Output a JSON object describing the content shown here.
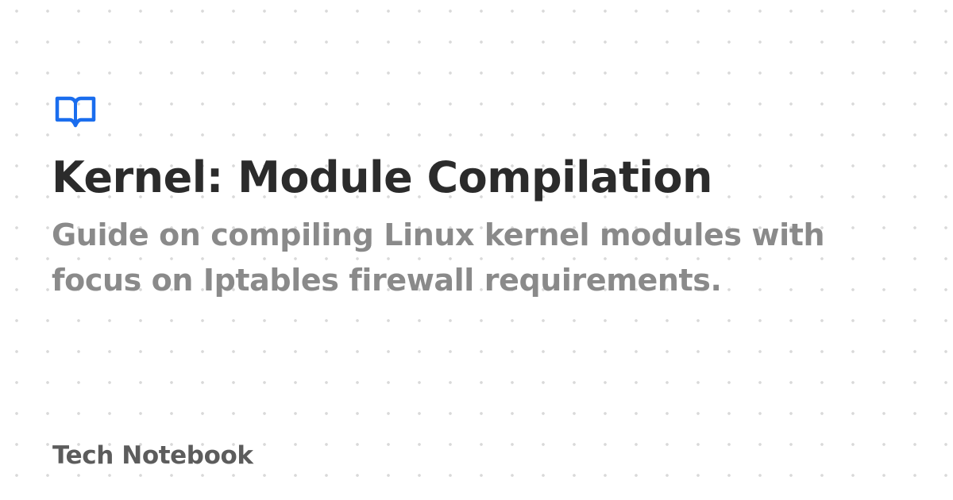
{
  "logo": {
    "icon": "open-book-icon",
    "color": "#1a6dee"
  },
  "title": "Kernel: Module Compilation",
  "subtitle": "Guide on compiling Linux kernel modules with focus on Iptables firewall requirements.",
  "site_name": "Tech Notebook",
  "colors": {
    "title": "#2b2b2b",
    "subtitle": "#8a8a8a",
    "site_name": "#5c5c5c",
    "background": "#ffffff",
    "dots": "#d9d9d9"
  }
}
